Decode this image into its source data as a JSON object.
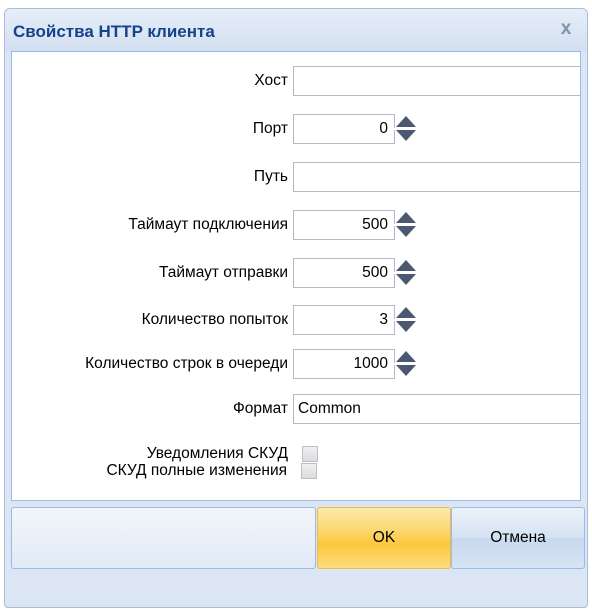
{
  "window": {
    "title": "Свойства HTTP клиента",
    "close_glyph": "x"
  },
  "form": {
    "host": {
      "label": "Хост",
      "value": ""
    },
    "port": {
      "label": "Порт",
      "value": "0"
    },
    "path": {
      "label": "Путь",
      "value": ""
    },
    "connect_timeout": {
      "label": "Таймаут подключения",
      "value": "500"
    },
    "send_timeout": {
      "label": "Таймаут отправки",
      "value": "500"
    },
    "retry_count": {
      "label": "Количество попыток",
      "value": "3"
    },
    "queue_rows": {
      "label": "Количество строк в очереди",
      "value": "1000"
    },
    "format": {
      "label": "Формат",
      "value": "Common"
    },
    "acs_notifications": {
      "label": "Уведомления СКУД",
      "checked": false
    },
    "acs_full_changes": {
      "label": "СКУД полные изменения",
      "checked": false
    }
  },
  "buttons": {
    "ok": "OK",
    "cancel": "Отмена"
  },
  "colors": {
    "title_text": "#15428b",
    "frame": "#dbe5f3",
    "ok_button": "#fcc73d",
    "cancel_button": "#d5e2f3"
  },
  "icons": {
    "close": "close-icon",
    "spinner": "spinner-arrows-icon",
    "checkbox": "checkbox-unchecked-icon"
  }
}
